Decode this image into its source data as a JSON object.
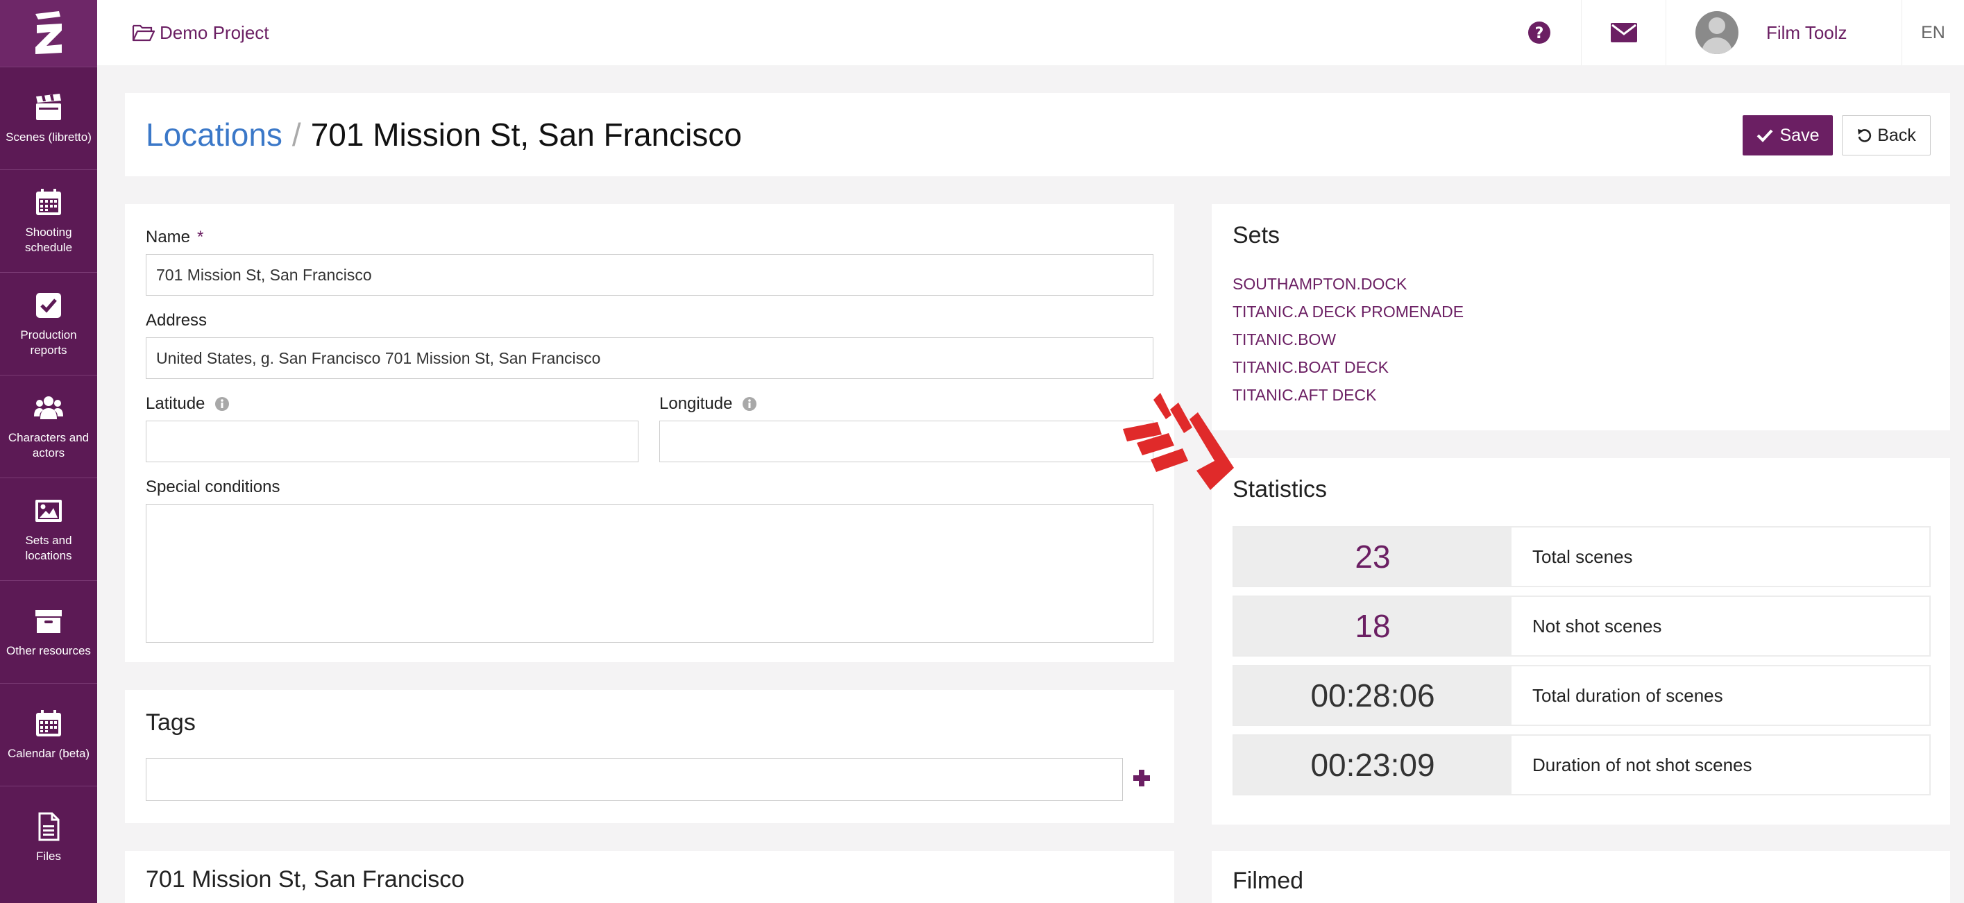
{
  "sidebar": {
    "items": [
      {
        "label": "Scenes (libretto)",
        "icon": "clapperboard-icon"
      },
      {
        "label": "Shooting schedule",
        "icon": "calendar-icon"
      },
      {
        "label": "Production reports",
        "icon": "checkbox-icon"
      },
      {
        "label": "Characters and actors",
        "icon": "users-icon"
      },
      {
        "label": "Sets and locations",
        "icon": "picture-icon"
      },
      {
        "label": "Other resources",
        "icon": "archive-box-icon"
      },
      {
        "label": "Calendar (beta)",
        "icon": "calendar-icon"
      },
      {
        "label": "Files",
        "icon": "file-icon"
      }
    ]
  },
  "topbar": {
    "project": "Demo Project",
    "user_name": "Film Toolz",
    "language": "EN"
  },
  "header": {
    "breadcrumb_link": "Locations",
    "separator": "/",
    "title": "701 Mission St, San Francisco",
    "save_label": "Save",
    "back_label": "Back"
  },
  "form": {
    "name_label": "Name",
    "required_mark": "*",
    "name_value": "701 Mission St, San Francisco",
    "address_label": "Address",
    "address_value": "United States, g. San Francisco 701 Mission St, San Francisco",
    "latitude_label": "Latitude",
    "latitude_value": "",
    "longitude_label": "Longitude",
    "longitude_value": "",
    "special_conditions_label": "Special conditions",
    "special_conditions_value": ""
  },
  "tags": {
    "title": "Tags",
    "value": ""
  },
  "location_map": {
    "title": "701 Mission St, San Francisco"
  },
  "sets": {
    "title": "Sets",
    "items": [
      "SOUTHAMPTON.DOCK",
      "TITANIC.A DECK PROMENADE",
      "TITANIC.BOW",
      "TITANIC.BOAT DECK",
      "TITANIC.AFT DECK"
    ]
  },
  "statistics": {
    "title": "Statistics",
    "rows": [
      {
        "value": "23",
        "label": "Total scenes",
        "color": "#6b1f63"
      },
      {
        "value": "18",
        "label": "Not shot scenes",
        "color": "#6b1f63"
      },
      {
        "value": "00:28:06",
        "label": "Total duration of scenes",
        "color": "#333333"
      },
      {
        "value": "00:23:09",
        "label": "Duration of not shot scenes",
        "color": "#333333"
      }
    ]
  },
  "filmed": {
    "title": "Filmed"
  },
  "colors": {
    "brand": "#6b1f63",
    "sidebar": "#5c1a55",
    "link_blue": "#3b78c8",
    "arrow_red": "#e02a2a"
  }
}
